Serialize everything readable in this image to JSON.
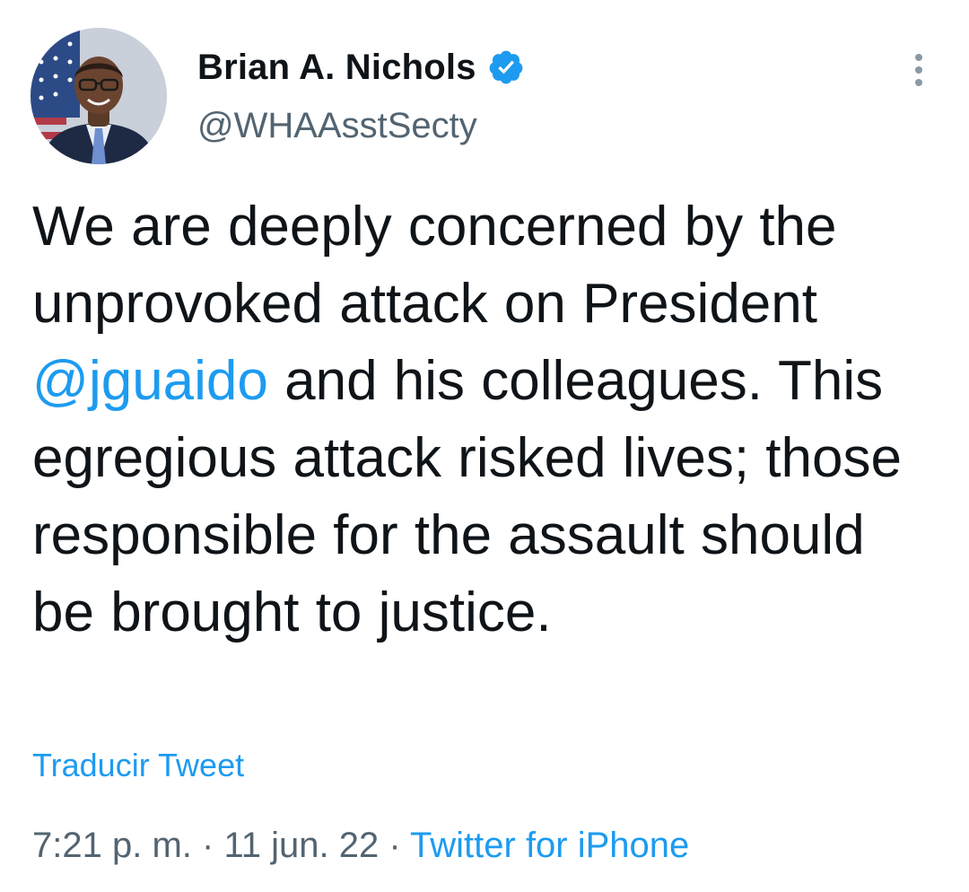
{
  "author": {
    "display_name": "Brian A. Nichols",
    "handle": "@WHAAsstSecty",
    "verified": true
  },
  "tweet": {
    "text_part1": "We are deeply concerned by the unprovoked attack on President ",
    "mention": "@jguaido",
    "text_part2": " and his colleagues. This egregious attack risked lives; those responsible for the assault should be brought to justice.",
    "translate_label": "Traducir Tweet",
    "time": "7:21 p. m.",
    "separator": "·",
    "date": "11 jun. 22",
    "source": "Twitter for iPhone"
  },
  "icons": {
    "verified": "verified-badge-icon",
    "more": "more-options-icon"
  },
  "colors": {
    "accent": "#1d9bf0",
    "text": "#0f1419",
    "secondary": "#536471"
  }
}
